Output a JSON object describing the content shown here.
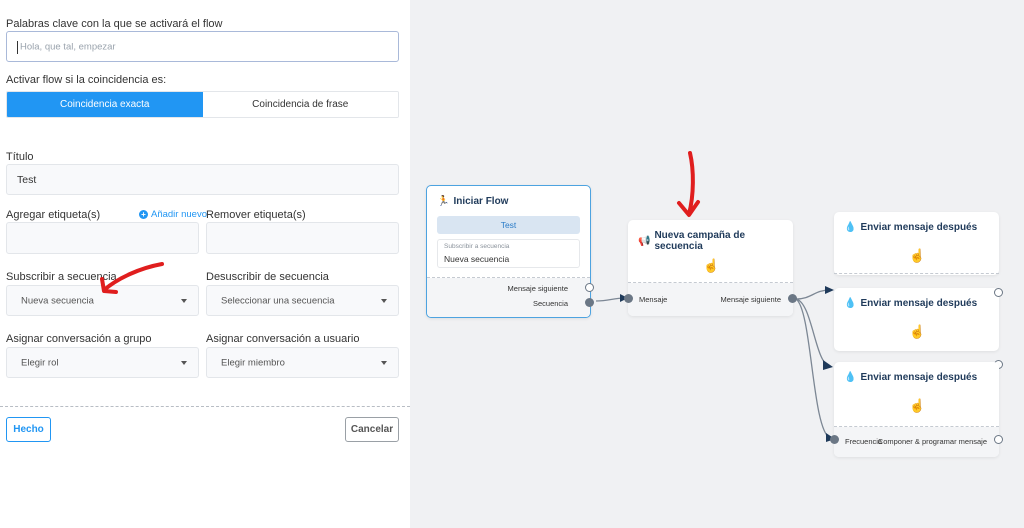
{
  "form": {
    "keywords_label": "Palabras clave con la que se activará el flow",
    "keywords_placeholder": "Hola, que tal, empezar",
    "activate_label": "Activar flow si la coincidencia es:",
    "match_options": [
      "Coincidencia exacta",
      "Coincidencia de frase"
    ],
    "match_selected": "Coincidencia exacta",
    "title_label": "Título",
    "title_value": "Test",
    "add_tag_label": "Agregar etiqueta(s)",
    "add_new_label": "Añadir nuevo",
    "remove_tag_label": "Remover etiqueta(s)",
    "subscribe_label": "Subscribir a secuencia",
    "subscribe_value": "Nueva secuencia",
    "unsubscribe_label": "Desuscribir de secuencia",
    "unsubscribe_value": "Seleccionar una secuencia",
    "group_label": "Asignar conversación a grupo",
    "group_value": "Elegir rol",
    "user_label": "Asignar conversación a usuario",
    "user_value": "Elegir miembro",
    "done_label": "Hecho",
    "cancel_label": "Cancelar"
  },
  "canvas": {
    "start_node": {
      "title": "Iniciar Flow",
      "test_label": "Test",
      "subscribe_label": "Subscribir a secuencia",
      "subscribe_value": "Nueva secuencia",
      "port_next": "Mensaje siguiente",
      "port_sequence": "Secuencia"
    },
    "sequence_node": {
      "title": "Nueva campaña de secuencia",
      "port_in": "Mensaje",
      "port_out": "Mensaje siguiente"
    },
    "send_nodes": [
      {
        "title": "Enviar mensaje después"
      },
      {
        "title": "Enviar mensaje después"
      },
      {
        "title": "Enviar mensaje después",
        "port_in": "Frecuencia",
        "port_out": "Componer & programar mensaje"
      }
    ]
  },
  "colors": {
    "accent": "#2196f3",
    "arrow": "#e01e1e",
    "edge": "#7c8794",
    "node_title": "#1f3a5a"
  }
}
